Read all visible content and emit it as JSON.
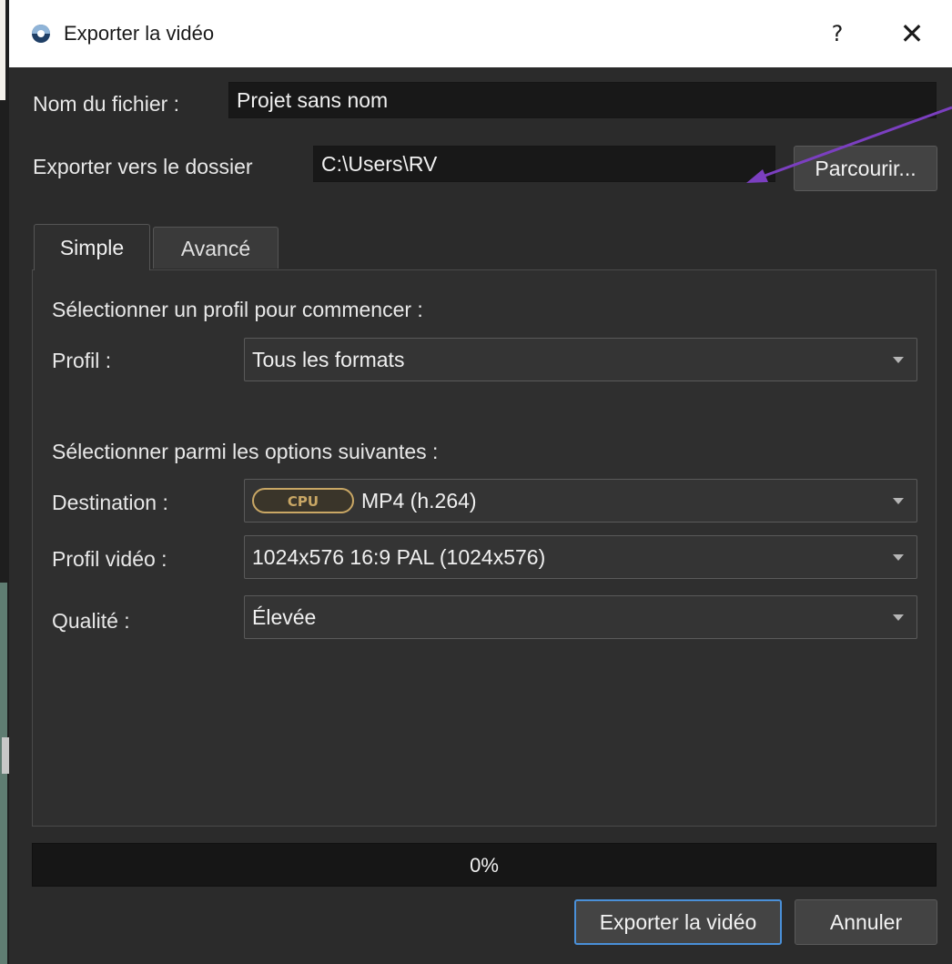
{
  "window": {
    "title": "Exporter la vidéo",
    "help_label": "?",
    "close_label": "✕"
  },
  "file_name": {
    "label": "Nom du fichier :",
    "value": "Projet sans nom"
  },
  "export_folder": {
    "label": "Exporter vers le dossier",
    "value": "C:\\Users\\RV",
    "browse_label": "Parcourir..."
  },
  "tabs": [
    {
      "label": "Simple",
      "active": true
    },
    {
      "label": "Avancé",
      "active": false
    }
  ],
  "simple": {
    "profile_heading": "Sélectionner un profil pour commencer :",
    "profile": {
      "label": "Profil :",
      "value": "Tous les formats"
    },
    "options_heading": "Sélectionner parmi les options suivantes :",
    "destination": {
      "label": "Destination :",
      "badge": "CPU",
      "value": "MP4 (h.264)"
    },
    "video_profile": {
      "label": "Profil vidéo :",
      "value": "1024x576 16:9 PAL (1024x576)"
    },
    "quality": {
      "label": "Qualité :",
      "value": "Élevée"
    }
  },
  "progress": {
    "percent": 0,
    "label": "0%"
  },
  "buttons": {
    "export": "Exporter la vidéo",
    "cancel": "Annuler"
  },
  "colors": {
    "background": "#2b2b2b",
    "field": "#181818",
    "accent_focus": "#4a90d9",
    "cpu_badge": "#c9a765",
    "annotation_arrow": "#7b3fc0"
  }
}
